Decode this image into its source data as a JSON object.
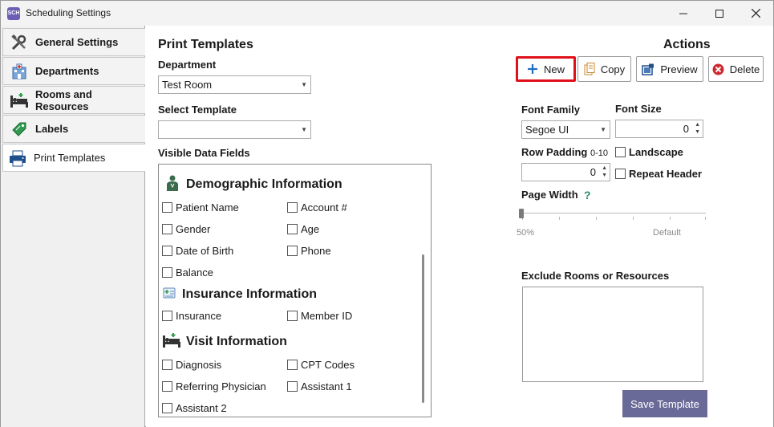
{
  "window": {
    "icon_text": "SCH",
    "title": "Scheduling Settings"
  },
  "sidebar": {
    "items": [
      {
        "label": "General Settings",
        "icon": "tools-icon"
      },
      {
        "label": "Departments",
        "icon": "hospital-icon"
      },
      {
        "label": "Rooms and Resources",
        "icon": "bed-icon"
      },
      {
        "label": "Labels",
        "icon": "tag-icon"
      },
      {
        "label": "Print Templates",
        "icon": "printer-icon",
        "active": true
      }
    ]
  },
  "main": {
    "title": "Print Templates",
    "department_label": "Department",
    "department_value": "Test Room",
    "select_template_label": "Select Template",
    "select_template_value": "",
    "visible_fields_label": "Visible Data Fields",
    "sections": [
      {
        "title": "Demographic Information",
        "icon": "person-icon"
      },
      {
        "title": "Insurance Information",
        "icon": "insurance-card-icon"
      },
      {
        "title": "Visit Information",
        "icon": "bed-icon"
      }
    ],
    "fields": {
      "patient_name": "Patient Name",
      "account": "Account #",
      "gender": "Gender",
      "age": "Age",
      "dob": "Date of Birth",
      "phone": "Phone",
      "balance": "Balance",
      "insurance": "Insurance",
      "member_id": "Member ID",
      "diagnosis": "Diagnosis",
      "cpt_codes": "CPT Codes",
      "referring_physician": "Referring Physician",
      "assistant1": "Assistant 1",
      "assistant2": "Assistant 2"
    }
  },
  "actions": {
    "title": "Actions",
    "new": "New",
    "copy": "Copy",
    "preview": "Preview",
    "delete": "Delete"
  },
  "format": {
    "font_family_label": "Font Family",
    "font_family_value": "Segoe UI",
    "font_size_label": "Font Size",
    "font_size_value": "0",
    "row_padding_label": "Row Padding",
    "row_padding_range": "0-10",
    "row_padding_value": "0",
    "landscape_label": "Landscape",
    "repeat_header_label": "Repeat Header",
    "page_width_label": "Page Width",
    "help_glyph": "?",
    "slider_min_label": "50%",
    "slider_max_label": "Default",
    "slider_level": 0
  },
  "exclude": {
    "label": "Exclude Rooms or Resources"
  },
  "save_label": "Save Template",
  "colors": {
    "new_highlight": "#e0101a",
    "save_bg": "#6a6a99",
    "help_green": "#2a8a6a",
    "plus_blue": "#1e6fc2",
    "delete_red": "#d0282f"
  }
}
